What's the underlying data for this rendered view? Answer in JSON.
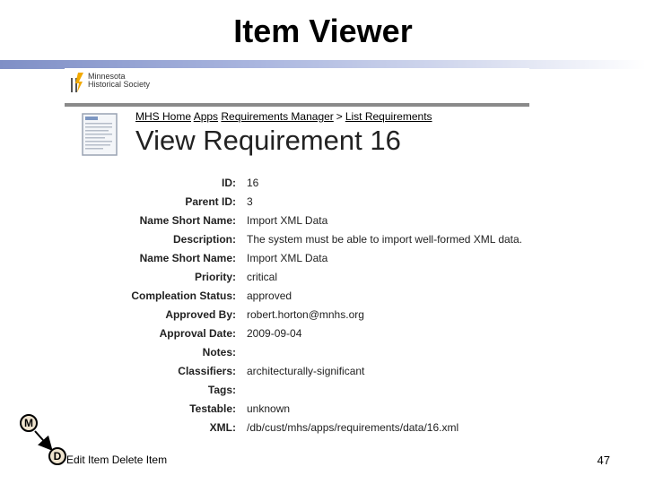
{
  "slide": {
    "title": "Item Viewer",
    "page_number": "47"
  },
  "site": {
    "logo_text": "Minnesota\nHistorical Society"
  },
  "breadcrumb": [
    {
      "label": "MHS Home"
    },
    {
      "label": "Apps"
    },
    {
      "label": "Requirements Manager"
    },
    {
      "label": "List Requirements"
    }
  ],
  "breadcrumb_separator": ">",
  "page": {
    "heading": "View Requirement 16"
  },
  "fields": [
    {
      "label": "ID:",
      "value": "16"
    },
    {
      "label": "Parent ID:",
      "value": "3"
    },
    {
      "label": "Name Short Name:",
      "value": "Import XML Data"
    },
    {
      "label": "Description:",
      "value": "The system must be able to import well-formed XML data."
    },
    {
      "label": "Name Short Name:",
      "value": "Import XML Data"
    },
    {
      "label": "Priority:",
      "value": "critical"
    },
    {
      "label": "Compleation Status:",
      "value": "approved"
    },
    {
      "label": "Approved By:",
      "value": "robert.horton@mnhs.org"
    },
    {
      "label": "Approval Date:",
      "value": "2009-09-04"
    },
    {
      "label": "Notes:",
      "value": ""
    },
    {
      "label": "Classifiers:",
      "value": "architecturally-significant"
    },
    {
      "label": "Tags:",
      "value": ""
    },
    {
      "label": "Testable:",
      "value": "unknown"
    },
    {
      "label": "XML:",
      "value": "/db/cust/mhs/apps/requirements/data/16.xml"
    }
  ],
  "actions": {
    "edit": "Edit Item",
    "delete": "Delete Item"
  },
  "diagram": {
    "node_m": "M",
    "node_d": "D"
  },
  "colors": {
    "node_fill": "#efe4cf",
    "title_bar": "#7f8fc6",
    "logo_accent": "#f2a900"
  }
}
